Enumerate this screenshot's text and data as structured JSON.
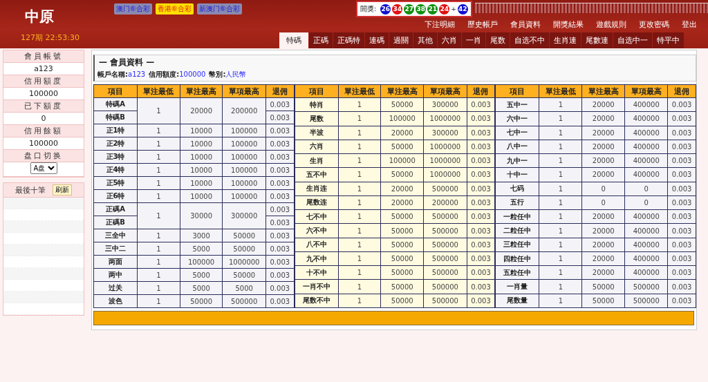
{
  "logo": "中原",
  "lotteries": [
    {
      "label": "澳门⑥合彩",
      "selected": false
    },
    {
      "label": "香港⑥合彩",
      "selected": true
    },
    {
      "label": "新澳门⑥合彩",
      "selected": false
    }
  ],
  "draw": {
    "label": "開獎:",
    "balls": [
      {
        "number": "26",
        "color": "#1010d0"
      },
      {
        "number": "34",
        "color": "#e01010"
      },
      {
        "number": "27",
        "color": "#109010"
      },
      {
        "number": "38",
        "color": "#109010"
      },
      {
        "number": "21",
        "color": "#109010"
      },
      {
        "number": "24",
        "color": "#e01010"
      }
    ],
    "plus": "+",
    "special": {
      "number": "42",
      "color": "#1010d0"
    }
  },
  "period": "127期 22:53:30",
  "nav_links": [
    "下注明細",
    "歷史帳戶",
    "會員資料",
    "開獎結果",
    "遊戲規則",
    "更改密碼",
    "登出"
  ],
  "tabs": [
    {
      "label": "特碼",
      "selected": true
    },
    {
      "label": "正碼",
      "selected": false
    },
    {
      "label": "正碼特",
      "selected": false
    },
    {
      "label": "連碼",
      "selected": false
    },
    {
      "label": "過關",
      "selected": false
    },
    {
      "label": "其他",
      "selected": false
    },
    {
      "label": "六肖",
      "selected": false
    },
    {
      "label": "一肖",
      "selected": false
    },
    {
      "label": "尾数",
      "selected": false
    },
    {
      "label": "自选不中",
      "selected": false
    },
    {
      "label": "生肖連",
      "selected": false
    },
    {
      "label": "尾數連",
      "selected": false
    },
    {
      "label": "自选中一",
      "selected": false
    },
    {
      "label": "特平中",
      "selected": false
    }
  ],
  "sidebar": {
    "fields": [
      {
        "label": "會員帳號",
        "value": "a123"
      },
      {
        "label": "信用額度",
        "value": "100000"
      },
      {
        "label": "已下額度",
        "value": "0"
      },
      {
        "label": "信用餘額",
        "value": "100000"
      }
    ],
    "switch_label": "盘口切换",
    "switch_value": "A盘",
    "recent_title": "最後十筆",
    "refresh": "刷新"
  },
  "panel": {
    "title": "— 會員資料 —",
    "account_label": "帳戶名稱:",
    "account": "a123",
    "credit_label": "信用額度:",
    "credit": "100000",
    "currency_label": "幣別:",
    "currency": "人民幣"
  },
  "tables": [
    {
      "columns": [
        "項目",
        "單注最低",
        "單注最高",
        "單項最高",
        "退佣"
      ],
      "rows": [
        {
          "items": [
            "特碼A",
            "特碼B"
          ],
          "min": "1",
          "max": "20000",
          "single": "200000",
          "rebates": [
            "0.003",
            "0.003"
          ]
        },
        {
          "items": [
            "正1特"
          ],
          "min": "1",
          "max": "10000",
          "single": "100000",
          "rebates": [
            "0.003"
          ]
        },
        {
          "items": [
            "正2特"
          ],
          "min": "1",
          "max": "10000",
          "single": "100000",
          "rebates": [
            "0.003"
          ]
        },
        {
          "items": [
            "正3特"
          ],
          "min": "1",
          "max": "10000",
          "single": "100000",
          "rebates": [
            "0.003"
          ]
        },
        {
          "items": [
            "正4特"
          ],
          "min": "1",
          "max": "10000",
          "single": "100000",
          "rebates": [
            "0.003"
          ]
        },
        {
          "items": [
            "正5特"
          ],
          "min": "1",
          "max": "10000",
          "single": "100000",
          "rebates": [
            "0.003"
          ]
        },
        {
          "items": [
            "正6特"
          ],
          "min": "1",
          "max": "10000",
          "single": "100000",
          "rebates": [
            "0.003"
          ]
        },
        {
          "items": [
            "正碼A",
            "正碼B"
          ],
          "min": "1",
          "max": "30000",
          "single": "300000",
          "rebates": [
            "0.003",
            "0.003"
          ]
        },
        {
          "items": [
            "三全中"
          ],
          "min": "1",
          "max": "3000",
          "single": "50000",
          "rebates": [
            "0.003"
          ]
        },
        {
          "items": [
            "三中二"
          ],
          "min": "1",
          "max": "5000",
          "single": "50000",
          "rebates": [
            "0.003"
          ]
        },
        {
          "items": [
            "两面"
          ],
          "min": "1",
          "max": "100000",
          "single": "1000000",
          "rebates": [
            "0.003"
          ]
        },
        {
          "items": [
            "两中"
          ],
          "min": "1",
          "max": "5000",
          "single": "50000",
          "rebates": [
            "0.003"
          ]
        },
        {
          "items": [
            "过关"
          ],
          "min": "1",
          "max": "5000",
          "single": "5000",
          "rebates": [
            "0.003"
          ]
        },
        {
          "items": [
            "波色"
          ],
          "min": "1",
          "max": "50000",
          "single": "500000",
          "rebates": [
            "0.003"
          ]
        }
      ]
    },
    {
      "columns": [
        "項目",
        "單注最低",
        "單注最高",
        "單項最高",
        "退佣"
      ],
      "rows": [
        {
          "items": [
            "特肖"
          ],
          "min": "1",
          "max": "50000",
          "single": "300000",
          "rebates": [
            "0.003"
          ]
        },
        {
          "items": [
            "尾数"
          ],
          "min": "1",
          "max": "100000",
          "single": "1000000",
          "rebates": [
            "0.003"
          ]
        },
        {
          "items": [
            "半波"
          ],
          "min": "1",
          "max": "20000",
          "single": "300000",
          "rebates": [
            "0.003"
          ]
        },
        {
          "items": [
            "六肖"
          ],
          "min": "1",
          "max": "50000",
          "single": "1000000",
          "rebates": [
            "0.003"
          ]
        },
        {
          "items": [
            "生肖"
          ],
          "min": "1",
          "max": "100000",
          "single": "1000000",
          "rebates": [
            "0.003"
          ]
        },
        {
          "items": [
            "五不中"
          ],
          "min": "1",
          "max": "50000",
          "single": "1000000",
          "rebates": [
            "0.003"
          ]
        },
        {
          "items": [
            "生肖连"
          ],
          "min": "1",
          "max": "20000",
          "single": "500000",
          "rebates": [
            "0.003"
          ]
        },
        {
          "items": [
            "尾数连"
          ],
          "min": "1",
          "max": "20000",
          "single": "200000",
          "rebates": [
            "0.003"
          ]
        },
        {
          "items": [
            "七不中"
          ],
          "min": "1",
          "max": "50000",
          "single": "500000",
          "rebates": [
            "0.003"
          ]
        },
        {
          "items": [
            "六不中"
          ],
          "min": "1",
          "max": "50000",
          "single": "500000",
          "rebates": [
            "0.003"
          ]
        },
        {
          "items": [
            "八不中"
          ],
          "min": "1",
          "max": "50000",
          "single": "500000",
          "rebates": [
            "0.003"
          ]
        },
        {
          "items": [
            "九不中"
          ],
          "min": "1",
          "max": "50000",
          "single": "500000",
          "rebates": [
            "0.003"
          ]
        },
        {
          "items": [
            "十不中"
          ],
          "min": "1",
          "max": "50000",
          "single": "500000",
          "rebates": [
            "0.003"
          ]
        },
        {
          "items": [
            "一肖不中"
          ],
          "min": "1",
          "max": "50000",
          "single": "500000",
          "rebates": [
            "0.003"
          ]
        },
        {
          "items": [
            "尾数不中"
          ],
          "min": "1",
          "max": "50000",
          "single": "500000",
          "rebates": [
            "0.003"
          ]
        }
      ]
    },
    {
      "columns": [
        "項目",
        "單注最低",
        "單注最高",
        "單項最高",
        "退佣"
      ],
      "rows": [
        {
          "items": [
            "五中一"
          ],
          "min": "1",
          "max": "20000",
          "single": "400000",
          "rebates": [
            "0.003"
          ]
        },
        {
          "items": [
            "六中一"
          ],
          "min": "1",
          "max": "20000",
          "single": "400000",
          "rebates": [
            "0.003"
          ]
        },
        {
          "items": [
            "七中一"
          ],
          "min": "1",
          "max": "20000",
          "single": "400000",
          "rebates": [
            "0.003"
          ]
        },
        {
          "items": [
            "八中一"
          ],
          "min": "1",
          "max": "20000",
          "single": "400000",
          "rebates": [
            "0.003"
          ]
        },
        {
          "items": [
            "九中一"
          ],
          "min": "1",
          "max": "20000",
          "single": "400000",
          "rebates": [
            "0.003"
          ]
        },
        {
          "items": [
            "十中一"
          ],
          "min": "1",
          "max": "20000",
          "single": "400000",
          "rebates": [
            "0.003"
          ]
        },
        {
          "items": [
            "七码"
          ],
          "min": "1",
          "max": "0",
          "single": "0",
          "rebates": [
            "0.003"
          ]
        },
        {
          "items": [
            "五行"
          ],
          "min": "1",
          "max": "0",
          "single": "0",
          "rebates": [
            "0.003"
          ]
        },
        {
          "items": [
            "一粒任中"
          ],
          "min": "1",
          "max": "20000",
          "single": "400000",
          "rebates": [
            "0.003"
          ]
        },
        {
          "items": [
            "二粒任中"
          ],
          "min": "1",
          "max": "20000",
          "single": "400000",
          "rebates": [
            "0.003"
          ]
        },
        {
          "items": [
            "三粒任中"
          ],
          "min": "1",
          "max": "20000",
          "single": "400000",
          "rebates": [
            "0.003"
          ]
        },
        {
          "items": [
            "四粒任中"
          ],
          "min": "1",
          "max": "20000",
          "single": "400000",
          "rebates": [
            "0.003"
          ]
        },
        {
          "items": [
            "五粒任中"
          ],
          "min": "1",
          "max": "20000",
          "single": "400000",
          "rebates": [
            "0.003"
          ]
        },
        {
          "items": [
            "一肖量"
          ],
          "min": "1",
          "max": "50000",
          "single": "500000",
          "rebates": [
            "0.003"
          ]
        },
        {
          "items": [
            "尾数量"
          ],
          "min": "1",
          "max": "50000",
          "single": "500000",
          "rebates": [
            "0.003"
          ]
        }
      ]
    }
  ]
}
